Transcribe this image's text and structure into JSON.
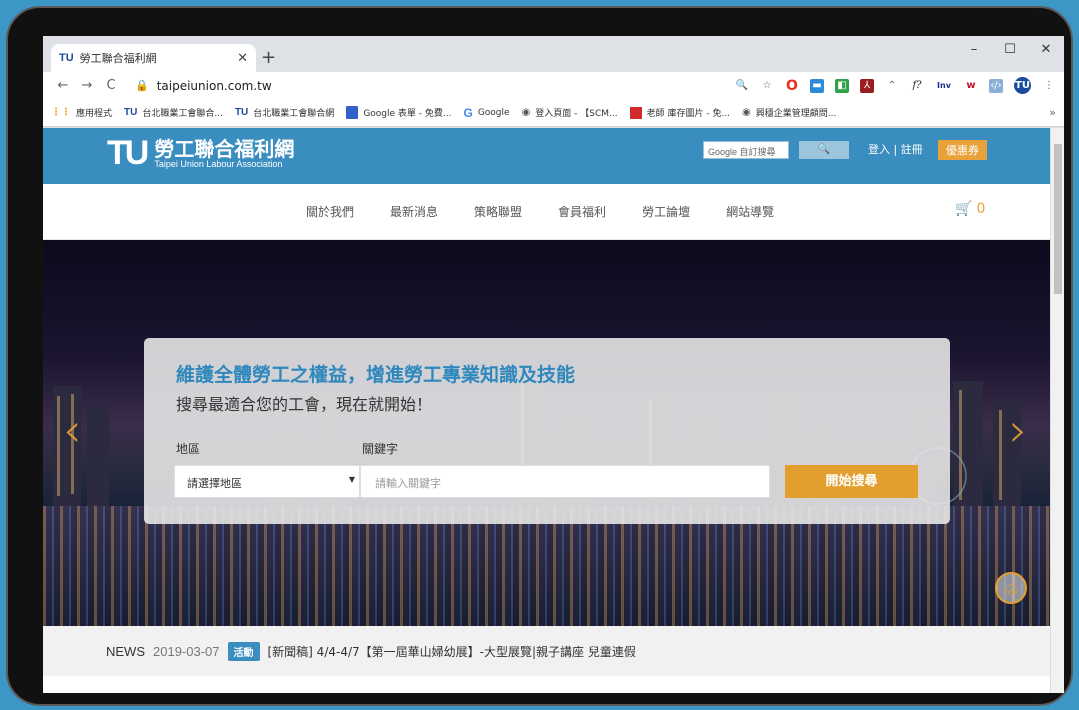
{
  "browser": {
    "tab_title": "勞工聯合福利網",
    "tab_favicon": "TU",
    "url": "taipeiunion.com.tw",
    "window_controls": [
      "–",
      "☐",
      "✕"
    ],
    "bookmarks": [
      {
        "icon": "apps-icon",
        "label": "應用程式"
      },
      {
        "icon": "tu-favicon",
        "label": "台北職業工會聯合..."
      },
      {
        "icon": "tu-favicon",
        "label": "台北職業工會聯合網"
      },
      {
        "icon": "sheets-icon",
        "label": "Google 表單 - 免費..."
      },
      {
        "icon": "google-icon",
        "label": "Google"
      },
      {
        "icon": "globe-icon",
        "label": "登入頁面 - 【SCM..."
      },
      {
        "icon": "photo-icon",
        "label": "老師 庫存圖片 - 免..."
      },
      {
        "icon": "globe-icon",
        "label": "興穩企業管理顧問..."
      }
    ]
  },
  "site": {
    "logo_mark": "TU",
    "logo_name": "勞工聯合福利網",
    "logo_subtitle": "Taipei Union Labour Association",
    "google_search_placeholder": "Google 自訂搜尋",
    "login_register": "登入 | 註冊",
    "coupon": "優惠券",
    "nav": [
      "關於我們",
      "最新消息",
      "策略聯盟",
      "會員福利",
      "勞工論壇",
      "網站導覽"
    ],
    "cart_count": "0",
    "colors": {
      "brand": "#3a8dbf",
      "accent": "#e39f2e"
    }
  },
  "hero": {
    "slogan": "維護全體勞工之權益，增進勞工專業知識及技能",
    "subtitle": "搜尋最適合您的工會，現在就開始！",
    "region_label": "地區",
    "keyword_label": "關鍵字",
    "region_select": "請選擇地區",
    "keyword_placeholder": "請輸入關鍵字",
    "search_button": "開始搜尋",
    "top_button": "TOP"
  },
  "news": {
    "label": "NEWS",
    "date": "2019-03-07",
    "badge": "活動",
    "headline": "[新聞稿] 4/4-4/7【第一屆華山婦幼展】-大型展覽|親子講座 兒童連假"
  }
}
